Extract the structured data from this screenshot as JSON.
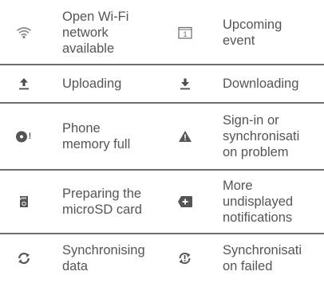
{
  "rows": [
    {
      "left": {
        "icon": "wifi-open-icon",
        "label": "Open Wi-Fi\nnetwork\navailable"
      },
      "right": {
        "icon": "calendar-event-icon",
        "label": "Upcoming\nevent",
        "calendar_number": "1"
      }
    },
    {
      "left": {
        "icon": "upload-icon",
        "label": "Uploading"
      },
      "right": {
        "icon": "download-icon",
        "label": "Downloading"
      }
    },
    {
      "left": {
        "icon": "phone-memory-full-icon",
        "label": "Phone\nmemory full",
        "badge": "!"
      },
      "right": {
        "icon": "warning-icon",
        "label": "Sign-in or\nsynchronisati\non problem"
      }
    },
    {
      "left": {
        "icon": "sd-card-icon",
        "label": "Preparing the\nmicroSD card"
      },
      "right": {
        "icon": "more-notifications-icon",
        "label": "More\nundisplayed\nnotifications"
      }
    },
    {
      "left": {
        "icon": "sync-icon",
        "label": "Synchronising\ndata"
      },
      "right": {
        "icon": "sync-failed-icon",
        "label": "Synchronisati\non failed"
      }
    }
  ],
  "colors": {
    "icon": "#5a5a5a",
    "text": "#555555",
    "separator": "#6e6e6e"
  }
}
